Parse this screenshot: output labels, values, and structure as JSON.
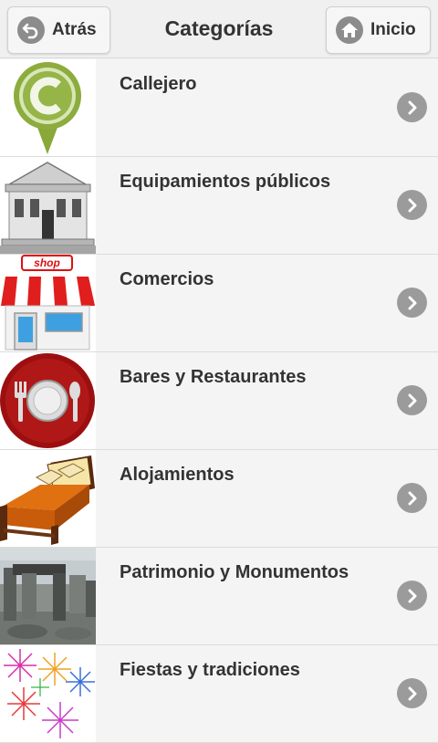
{
  "header": {
    "title": "Categorías",
    "back_label": "Atrás",
    "home_label": "Inicio"
  },
  "categories": [
    {
      "label": "Callejero",
      "icon": "map-pin-c-icon"
    },
    {
      "label": "Equipamientos públicos",
      "icon": "public-building-icon"
    },
    {
      "label": "Comercios",
      "icon": "shop-icon"
    },
    {
      "label": "Bares y Restaurantes",
      "icon": "plate-cutlery-icon"
    },
    {
      "label": "Alojamientos",
      "icon": "bed-icon"
    },
    {
      "label": "Patrimonio y Monumentos",
      "icon": "stonehenge-photo"
    },
    {
      "label": "Fiestas y tradiciones",
      "icon": "fireworks-icon"
    }
  ],
  "shop_sign": "shop"
}
